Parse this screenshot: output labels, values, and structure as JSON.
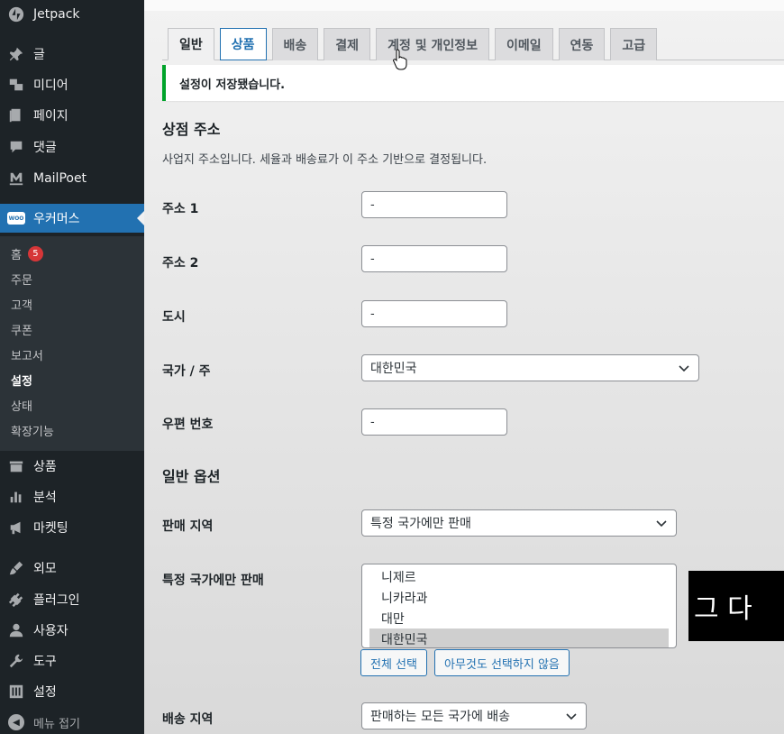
{
  "sidebar": {
    "top_items": [
      {
        "label": "Jetpack",
        "icon": "jetpack-icon"
      },
      {
        "label": "글",
        "icon": "pin-icon"
      },
      {
        "label": "미디어",
        "icon": "media-icon"
      },
      {
        "label": "페이지",
        "icon": "page-icon"
      },
      {
        "label": "댓글",
        "icon": "comment-icon"
      },
      {
        "label": "MailPoet",
        "icon": "mailpoet-icon"
      }
    ],
    "woocommerce": {
      "label": "우커머스",
      "badge": "WOO"
    },
    "woo_submenu": {
      "home": {
        "label": "홈",
        "count": "5"
      },
      "orders": "주문",
      "customers": "고객",
      "coupons": "쿠폰",
      "reports": "보고서",
      "settings": "설정",
      "status": "상태",
      "extensions": "확장기능"
    },
    "bottom_items": [
      {
        "label": "상품",
        "icon": "products-icon"
      },
      {
        "label": "분석",
        "icon": "analytics-icon"
      },
      {
        "label": "마켓팅",
        "icon": "megaphone-icon"
      },
      {
        "label": "외모",
        "icon": "brush-icon"
      },
      {
        "label": "플러그인",
        "icon": "plugin-icon"
      },
      {
        "label": "사용자",
        "icon": "user-icon"
      },
      {
        "label": "도구",
        "icon": "wrench-icon"
      },
      {
        "label": "설정",
        "icon": "settings-icon"
      }
    ],
    "collapse": "메뉴 접기"
  },
  "tabs": [
    "일반",
    "상품",
    "배송",
    "결제",
    "계정 및 개인정보",
    "이메일",
    "연동",
    "고급"
  ],
  "notice": "설정이 저장됐습니다.",
  "store_address": {
    "title": "상점 주소",
    "description": "사업지 주소입니다. 세율과 배송료가 이 주소 기반으로 결정됩니다.",
    "address1_label": "주소 1",
    "address1_value": "-",
    "address2_label": "주소 2",
    "address2_value": "-",
    "city_label": "도시",
    "city_value": "-",
    "country_label": "국가 / 주",
    "country_value": "대한민국",
    "postcode_label": "우편 번호",
    "postcode_value": "-"
  },
  "general_options": {
    "title": "일반 옵션",
    "selling_location_label": "판매 지역",
    "selling_location_value": "특정 국가에만 판매",
    "specific_countries_label": "특정 국가에만 판매",
    "countries": [
      "니제르",
      "니카라과",
      "대만",
      "대한민국"
    ],
    "selected_country": "대한민국",
    "select_all_button": "전체 선택",
    "select_none_button": "아무것도 선택하지 않음",
    "shipping_location_label": "배송 지역",
    "shipping_location_value": "판매하는 모든 국가에 배송"
  },
  "video_subtitle": "그 다",
  "colors": {
    "accent": "#2271b1",
    "success": "#00a32a",
    "badge": "#d63638",
    "sidebar": "#1d2327"
  }
}
